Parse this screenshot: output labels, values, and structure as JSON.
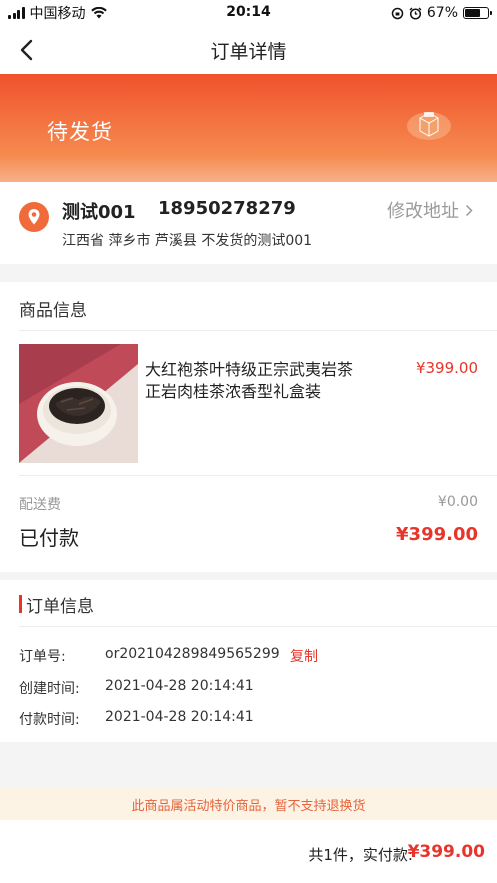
{
  "status_bar": {
    "carrier": "中国移动",
    "time": "20:14",
    "battery": "67%",
    "battery_level": 0.67
  },
  "nav": {
    "title": "订单详情"
  },
  "banner": {
    "status": "待发货"
  },
  "address": {
    "name": "测试001",
    "phone": "18950278279",
    "edit_label": "修改地址",
    "detail": "江西省 萍乡市 芦溪县 不发货的测试001"
  },
  "goods": {
    "section_title": "商品信息",
    "product": {
      "name": "大红袍茶叶特级正宗武夷岩茶正岩肉桂茶浓香型礼盒装",
      "price": "¥399.00"
    },
    "shipping_label": "配送费",
    "shipping_value": "¥0.00",
    "paid_label": "已付款",
    "paid_value": "¥399.00"
  },
  "order": {
    "section_title": "订单信息",
    "rows": [
      {
        "label": "订单号:",
        "value": "or202104289849565299"
      },
      {
        "label": "创建时间:",
        "value": "2021-04-28 20:14:41"
      },
      {
        "label": "付款时间:",
        "value": "2021-04-28 20:14:41"
      }
    ],
    "copy_label": "复制"
  },
  "notice": {
    "text": "此商品属活动特价商品，暂不支持退换货"
  },
  "bottom": {
    "summary": "共1件，实付款:",
    "total": "¥399.00"
  },
  "colors": {
    "accent": "#e8352b",
    "banner_start": "#f0522c",
    "banner_end": "#f7b08a"
  }
}
